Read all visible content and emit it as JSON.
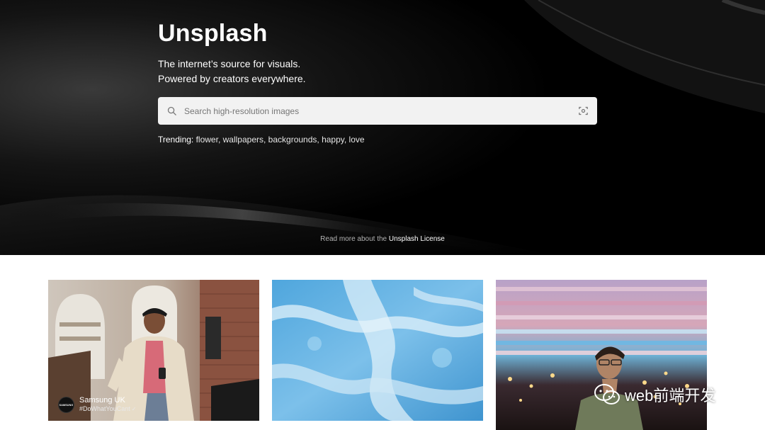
{
  "hero": {
    "title": "Unsplash",
    "subtitle_line1": "The internet’s source for visuals.",
    "subtitle_line2": "Powered by creators everywhere.",
    "search": {
      "placeholder": "Search high-resolution images",
      "value": "",
      "icon": "search-icon",
      "visual_search_icon": "visual-search-icon"
    },
    "trending": {
      "label": "Trending:",
      "items": [
        "flower",
        "wallpapers",
        "backgrounds",
        "happy",
        "love"
      ]
    },
    "license": {
      "prefix": "Read more about the ",
      "link": "Unsplash License"
    }
  },
  "photos": [
    {
      "kind": "man walking with phone",
      "sponsor": {
        "avatar_text": "SAMSUNG",
        "name": "Samsung UK",
        "tag": "#DoWhatYouCant",
        "check": "✓"
      }
    },
    {
      "kind": "blue fluid art"
    },
    {
      "kind": "man with glasses under lights"
    }
  ],
  "watermark": {
    "text": "web前端开发",
    "icon": "wechat-icon"
  },
  "colors": {
    "hero_bg": "#000000",
    "search_bg": "#f2f2f2",
    "page_bg": "#ffffff"
  }
}
